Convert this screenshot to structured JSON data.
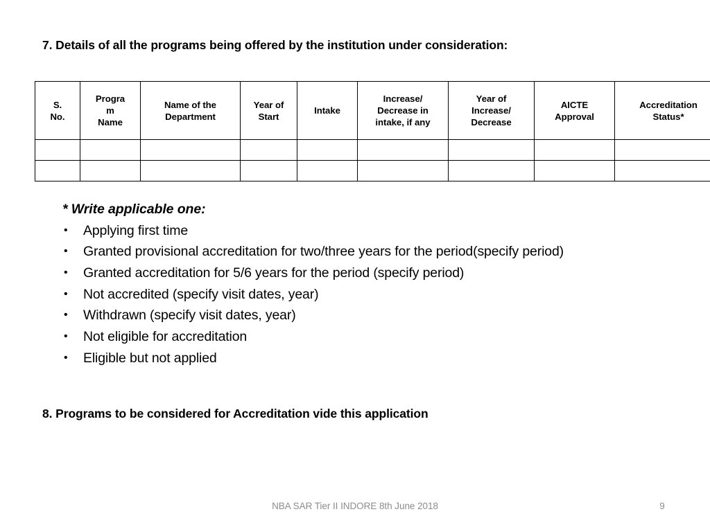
{
  "slide": {
    "heading_7": "7. Details of all the programs being offered by the institution under consideration:",
    "heading_8": "8. Programs to be considered for Accreditation vide this application"
  },
  "table": {
    "headers": [
      "S.\nNo.",
      "Progra\nm\nName",
      "Name of the\nDepartment",
      "Year of\nStart",
      "Intake",
      "Increase/\nDecrease  in\nintake, if any",
      "Year of\nIncrease/\nDecrease",
      "AICTE\nApproval",
      "Accreditation\nStatus*"
    ],
    "rows": [
      [
        "",
        "",
        "",
        "",
        "",
        "",
        "",
        "",
        ""
      ],
      [
        "",
        "",
        "",
        "",
        "",
        "",
        "",
        "",
        ""
      ]
    ]
  },
  "note": {
    "title": "* Write applicable one:",
    "bullet_marker": "•",
    "items": [
      "Applying first time",
      "Granted provisional accreditation for two/three years for the period(specify period)",
      "Granted accreditation for 5/6 years for the period (specify period)",
      "Not accredited (specify visit dates, year)",
      "Withdrawn (specify visit dates, year)",
      "Not eligible for accreditation",
      "Eligible but not applied"
    ]
  },
  "footer": {
    "text": "NBA SAR Tier II INDORE 8th June 2018",
    "page_number": "9"
  },
  "colors": {
    "background": "#ffffff",
    "text": "#000000",
    "footer_text": "#8c8c8c",
    "table_border": "#000000"
  }
}
